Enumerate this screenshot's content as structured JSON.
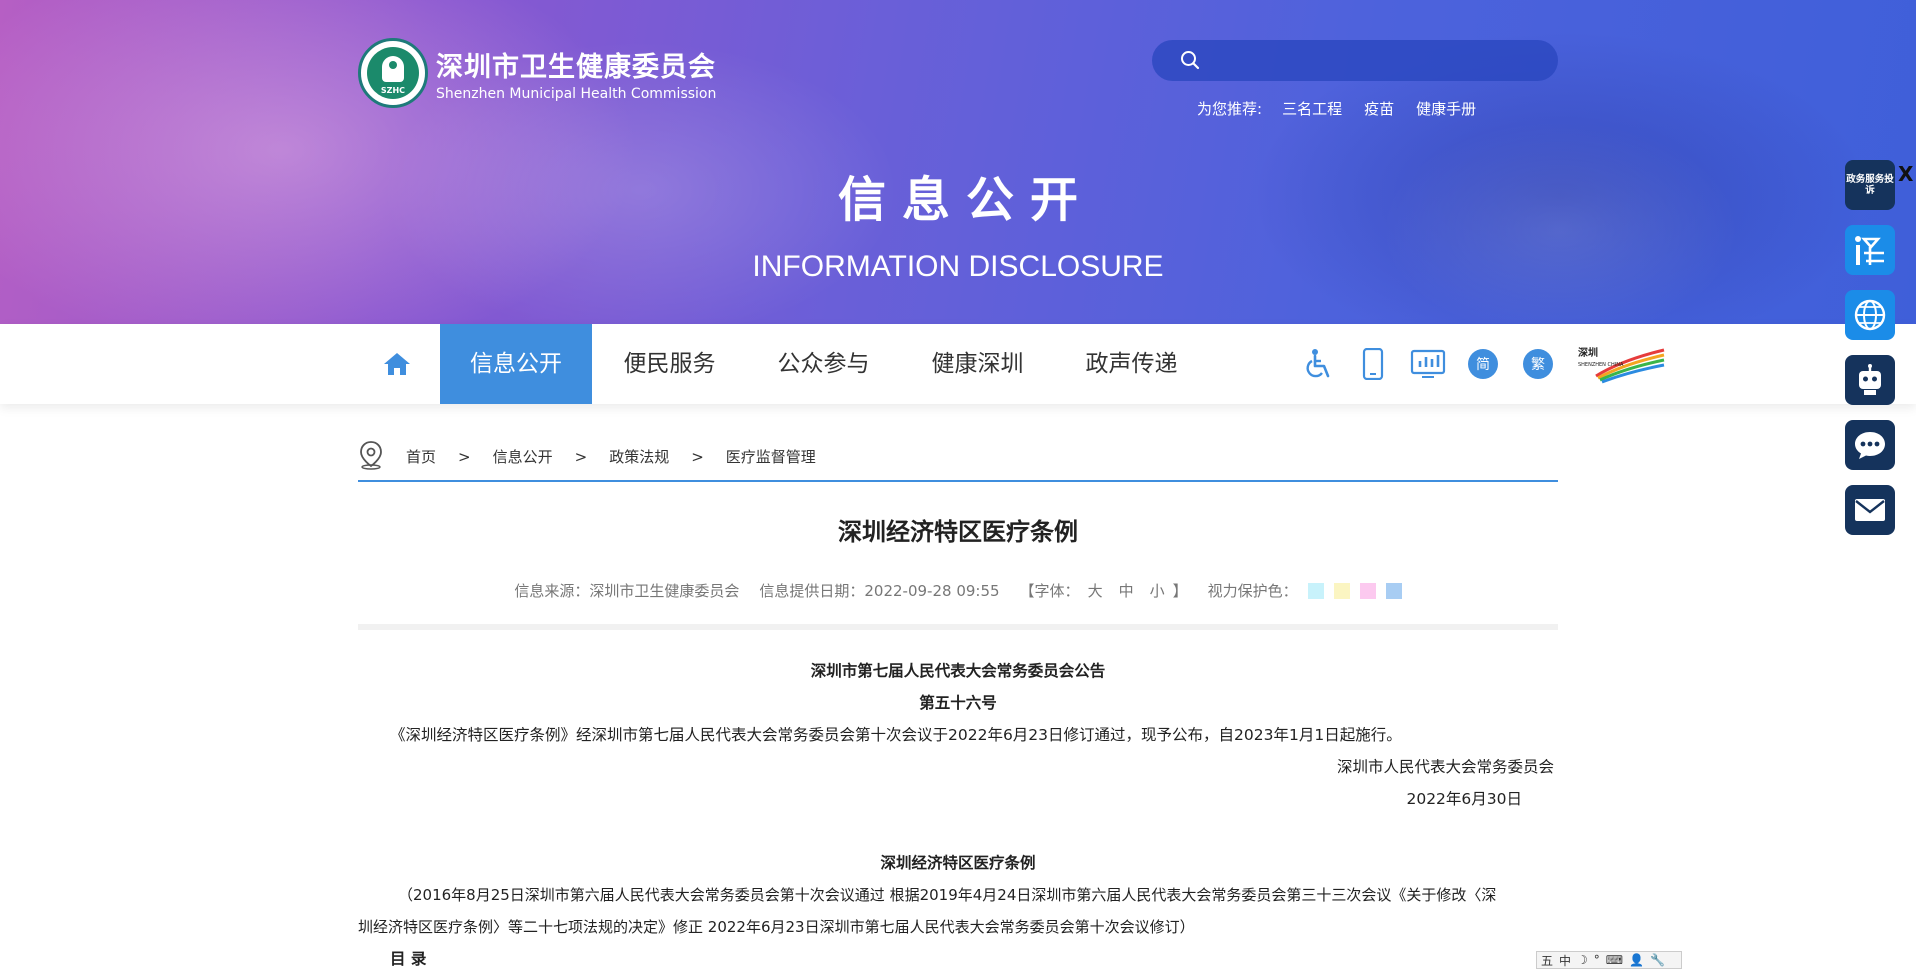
{
  "header": {
    "logo_cn": "深圳市卫生健康委员会",
    "logo_en": "Shenzhen Municipal Health Commission",
    "logo_badge": "SZHC",
    "search_placeholder": "",
    "recommend_label": "为您推荐:",
    "recommend_links": [
      "三名工程",
      "疫苗",
      "健康手册"
    ]
  },
  "banner": {
    "title_cn": "信息公开",
    "title_en": "INFORMATION DISCLOSURE"
  },
  "nav": {
    "items": [
      "信息公开",
      "便民服务",
      "公众参与",
      "健康深圳",
      "政声传递"
    ],
    "active_index": 0,
    "tools": {
      "simplified": "简",
      "traditional": "繁"
    },
    "sz_logo_text": "深圳政府在线 SHENZHEN CHINA",
    "accent_color": "#3f8ede"
  },
  "breadcrumb": [
    "首页",
    "信息公开",
    "政策法规",
    "医疗监督管理"
  ],
  "breadcrumb_sep": ">",
  "article": {
    "title": "深圳经济特区医疗条例",
    "meta_source": "信息来源：深圳市卫生健康委员会",
    "meta_date": "信息提供日期：2022-09-28 09:55",
    "font_label_open": "【字体：",
    "font_sizes": [
      "大",
      "中",
      "小"
    ],
    "font_label_close": "】",
    "eye_label": "视力保护色：",
    "eye_colors": [
      "#c8f2fb",
      "#fbf5c2",
      "#fcc9ef",
      "#a8cdf3"
    ],
    "lines": [
      "深圳市第七届人民代表大会常务委员会公告",
      "第五十六号",
      "《深圳经济特区医疗条例》经深圳市第七届人民代表大会常务委员会第十次会议于2022年6月23日修订通过，现予公布，自2023年1月1日起施行。",
      "深圳市人民代表大会常务委员会",
      "2022年6月30日",
      "深圳经济特区医疗条例",
      "（2016年8月25日深圳市第六届人民代表大会常务委员会第十次会议通过 根据2019年4月24日深圳市第六届人民代表大会常务委员会第三十三次会议《关于修改〈深",
      "圳经济特区医疗条例〉等二十七项法规的决定》修正 2022年6月23日深圳市第七届人民代表大会常务委员会第十次会议修订）",
      "目  录"
    ]
  },
  "float": {
    "service_label": "政务服务投诉",
    "close": "X"
  },
  "ime": {
    "items": [
      "五",
      "中",
      "☽",
      "°",
      "⌨",
      "👤",
      "🔧"
    ]
  }
}
